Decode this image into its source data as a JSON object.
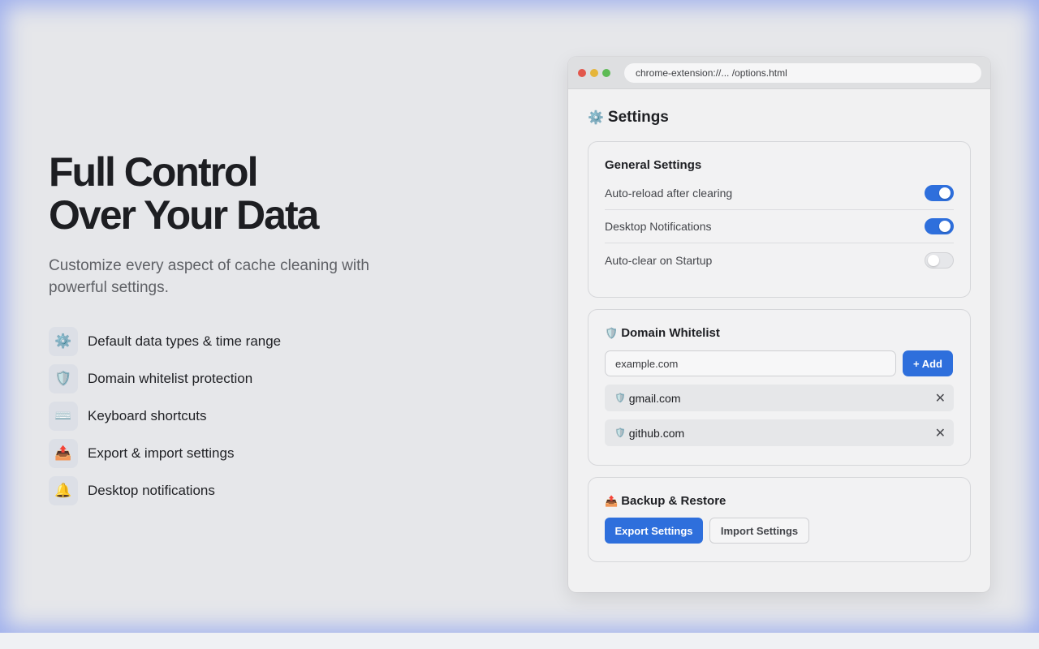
{
  "hero": {
    "title_line1": "Full Control",
    "title_line2": "Over Your Data",
    "subtitle": "Customize every aspect of cache cleaning with powerful settings.",
    "features": [
      {
        "icon": "gear-icon",
        "glyph": "⚙️",
        "label": "Default data types & time range"
      },
      {
        "icon": "shield-icon",
        "glyph": "🛡️",
        "label": "Domain whitelist protection"
      },
      {
        "icon": "keyboard-icon",
        "glyph": "⌨️",
        "label": "Keyboard shortcuts"
      },
      {
        "icon": "export-tray-icon",
        "glyph": "📤",
        "label": "Export & import settings"
      },
      {
        "icon": "bell-icon",
        "glyph": "🔔",
        "label": "Desktop notifications"
      }
    ]
  },
  "browser": {
    "url": "chrome-extension://... /options.html"
  },
  "settings": {
    "title_icon": "⚙️",
    "title": "Settings",
    "general": {
      "title": "General Settings",
      "rows": [
        {
          "label": "Auto-reload after clearing",
          "enabled": true
        },
        {
          "label": "Desktop Notifications",
          "enabled": true
        },
        {
          "label": "Auto-clear on Startup",
          "enabled": false
        }
      ]
    },
    "whitelist": {
      "icon": "🛡️",
      "title": "Domain Whitelist",
      "input_placeholder": "example.com",
      "add_label": "+ Add",
      "domains": [
        "gmail.com",
        "github.com"
      ],
      "remove_glyph": "✕"
    },
    "backup": {
      "icon": "📤",
      "title": "Backup & Restore",
      "export_label": "Export Settings",
      "import_label": "Import Settings"
    }
  },
  "colors": {
    "accent": "#2e6fdc",
    "glow": "#6080f0"
  }
}
